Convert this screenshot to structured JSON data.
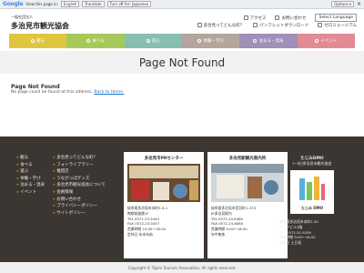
{
  "translate_bar": {
    "logo": "Google",
    "view_label": "View this page in:",
    "language": "English",
    "translate_btn": "Translate",
    "turn_off": "Turn off for: Japanese",
    "options": "Options ▾"
  },
  "header": {
    "org_prefix": "一般社団法人",
    "site_name": "多治見市観光協会",
    "links_row1": [
      "アクセス",
      "お問い合わせ",
      "Select Language"
    ],
    "links_row2": [
      "多治見ってどんな町？",
      "パンフレットダウンロード",
      "ゼロミュージアム"
    ]
  },
  "nav": {
    "items": [
      {
        "label": "観る",
        "color": "#e0c63e"
      },
      {
        "label": "食べる",
        "color": "#a6c95a"
      },
      {
        "label": "遊ぶ",
        "color": "#86bfb0"
      },
      {
        "label": "体験・学び",
        "color": "#b4a69d"
      },
      {
        "label": "泊まる・温泉",
        "color": "#9f8fb9"
      },
      {
        "label": "イベント",
        "color": "#e38b94"
      }
    ]
  },
  "page": {
    "title": "Page Not Found",
    "heading": "Page Not Found",
    "message": "No page could be found at this address.",
    "back_link": "Back to Home."
  },
  "footer": {
    "col1": [
      "観る",
      "食べる",
      "遊ぶ",
      "体験・学び",
      "泊まる・温泉",
      "イベント"
    ],
    "col2": [
      "多治見ってどんな町？",
      "フォトライブラリー",
      "推奨店",
      "うながっぱグッズ",
      "多治見市観光協会について",
      "会員情報",
      "お問い合わせ",
      "プライバシーポリシー",
      "サイトポリシー"
    ],
    "cards": [
      {
        "title": "多治見市PRセンター",
        "address": "岐阜県多治見市本町5-9-1",
        "address2": "陶都創造館1F",
        "tel": "TEL 0572-23-5444",
        "fax": "FAX 0572-23-5457",
        "hours": "営業時間 10:00〜18:00",
        "closed": "定休日 年末年始"
      },
      {
        "title": "多治見駅観光案内所",
        "address": "岐阜県多治見市音羽町1-233",
        "address2": "JR多治見駅内",
        "tel": "TEL 0572-24-6460",
        "fax": "FAX 0572-24-6460",
        "hours": "営業時間 9:00〜18:00",
        "closed": "年中無休"
      },
      {
        "title": "たじみDMO",
        "subtitle": "(一社)多治見市観光協会",
        "logo_text": "たじみ DMO",
        "address": "岐阜県多治見市本町5-20",
        "address2": "ヒラクビル3階",
        "tel": "TEL 0572-51-9259",
        "hours": "営業時間 9:00〜18:00",
        "closed": "定休日 土日祝"
      }
    ],
    "copyright": "Copyright © Tajimi Tourism Association. All rights reserved."
  }
}
